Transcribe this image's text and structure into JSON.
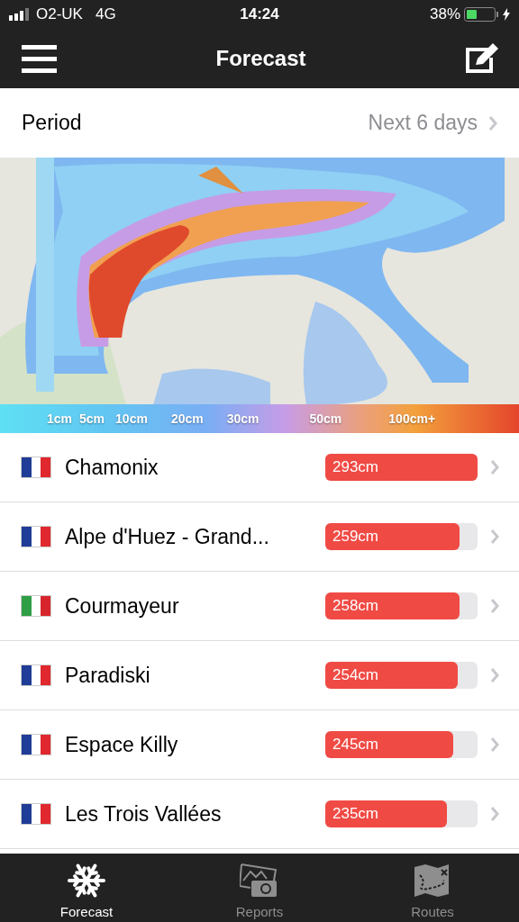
{
  "status_bar": {
    "carrier": "O2-UK",
    "network": "4G",
    "time": "14:24",
    "battery": "38%"
  },
  "nav_bar": {
    "title": "Forecast"
  },
  "period": {
    "label": "Period",
    "value": "Next 6 days"
  },
  "legend": [
    "1cm",
    "5cm",
    "10cm",
    "20cm",
    "30cm",
    "50cm",
    "100cm+"
  ],
  "resorts": [
    {
      "name": "Chamonix",
      "kind": "france",
      "snow": "293cm",
      "level": 1.0
    },
    {
      "name": "Alpe d'Huez - Grand...",
      "kind": "france",
      "snow": "259cm",
      "level": 0.88
    },
    {
      "name": "Courmayeur",
      "kind": "italy",
      "snow": "258cm",
      "level": 0.88
    },
    {
      "name": "Paradiski",
      "kind": "france",
      "snow": "254cm",
      "level": 0.87
    },
    {
      "name": "Espace Killy",
      "kind": "france",
      "snow": "245cm",
      "level": 0.84
    },
    {
      "name": "Les Trois Vallées",
      "kind": "france",
      "snow": "235cm",
      "level": 0.8
    }
  ],
  "tab_bar": [
    {
      "label": "Forecast",
      "selected": true
    },
    {
      "label": "Reports",
      "selected": false
    },
    {
      "label": "Routes",
      "selected": false
    }
  ]
}
